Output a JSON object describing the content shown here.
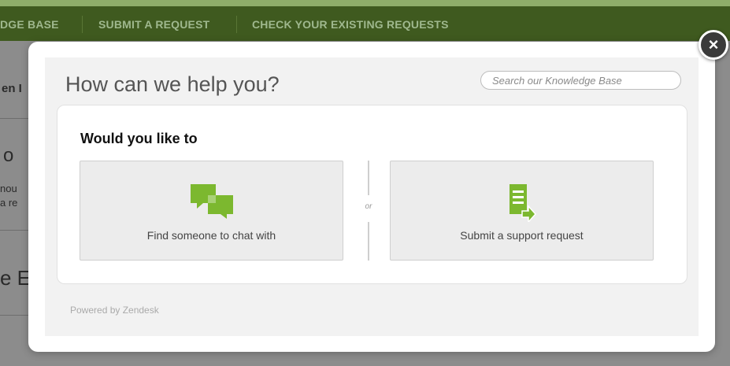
{
  "nav": {
    "items": [
      "DGE BASE",
      "SUBMIT A REQUEST",
      "CHECK YOUR EXISTING REQUESTS"
    ]
  },
  "background": {
    "frag1": "en I",
    "frag2": "o",
    "frag3": "nou",
    "frag4": "a re",
    "frag5": "e E"
  },
  "modal": {
    "title": "How can we help you?",
    "search_placeholder": "Search our Knowledge Base",
    "heading": "Would you like to",
    "options": [
      {
        "label": "Find someone to chat with",
        "icon": "chat-bubbles-icon"
      },
      {
        "label": "Submit a support request",
        "icon": "document-arrow-icon"
      }
    ],
    "or_label": "or",
    "powered_by": "Powered by Zendesk",
    "close_label": "×"
  },
  "colors": {
    "accent_green": "#7cb82f",
    "nav_bg": "#3f5a1f"
  }
}
